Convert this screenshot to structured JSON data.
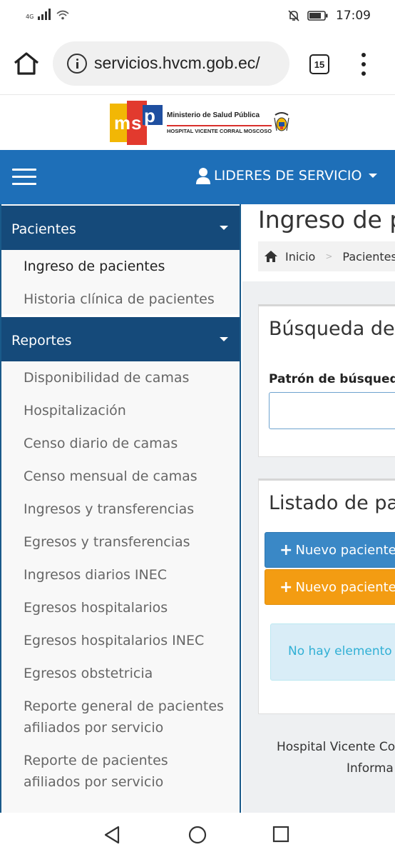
{
  "status_bar": {
    "network": "4G",
    "time": "17:09",
    "icons": [
      "signal-icon",
      "wifi-icon",
      "mute-icon",
      "battery-icon"
    ]
  },
  "browser": {
    "url": "servicios.hvcm.gob.ec/",
    "tab_count": "15",
    "icons": [
      "home-icon",
      "info-icon",
      "tabs-icon",
      "more-vert-icon"
    ]
  },
  "logo": {
    "mark": "msp",
    "line1": "Ministerio de Salud Pública",
    "line2": "HOSPITAL VICENTE CORRAL MOSCOSO"
  },
  "nav": {
    "user_label": "LIDERES DE SERVICIO"
  },
  "sidebar": {
    "groups": [
      {
        "title": "Pacientes",
        "items": [
          {
            "label": "Ingreso de pacientes",
            "active": true
          },
          {
            "label": "Historia clínica de pacientes",
            "active": false
          }
        ]
      },
      {
        "title": "Reportes",
        "items": [
          {
            "label": "Disponibilidad de camas"
          },
          {
            "label": "Hospitalización"
          },
          {
            "label": "Censo diario de camas"
          },
          {
            "label": "Censo mensual de camas"
          },
          {
            "label": "Ingresos y transferencias"
          },
          {
            "label": "Egresos y transferencias"
          },
          {
            "label": "Ingresos diarios INEC"
          },
          {
            "label": "Egresos hospitalarios"
          },
          {
            "label": "Egresos hospitalarios INEC"
          },
          {
            "label": "Egresos obstetricia"
          },
          {
            "label": "Reporte general de pacientes afiliados por servicio"
          },
          {
            "label": "Reporte de pacientes afiliados por servicio"
          }
        ]
      }
    ]
  },
  "main": {
    "page_title": "Ingreso de pa",
    "breadcrumb": [
      "Inicio",
      "Pacientes"
    ],
    "search_panel": {
      "title": "Búsqueda del",
      "field_label": "Patrón de búsqueda",
      "input_value": ""
    },
    "list_panel": {
      "title": "Listado de pac",
      "button_new_1": "Nuevo paciente",
      "button_new_2": "Nuevo paciente",
      "empty_message": "No hay elemento"
    },
    "footer": {
      "line1": "Hospital Vicente Co",
      "line2": "Informa"
    }
  },
  "colors": {
    "nav_blue": "#1e6fb8",
    "sidebar_header": "#154a7a",
    "btn_blue": "#3a88c6",
    "btn_orange": "#f39c12",
    "alert_info": "#d9edf7"
  }
}
